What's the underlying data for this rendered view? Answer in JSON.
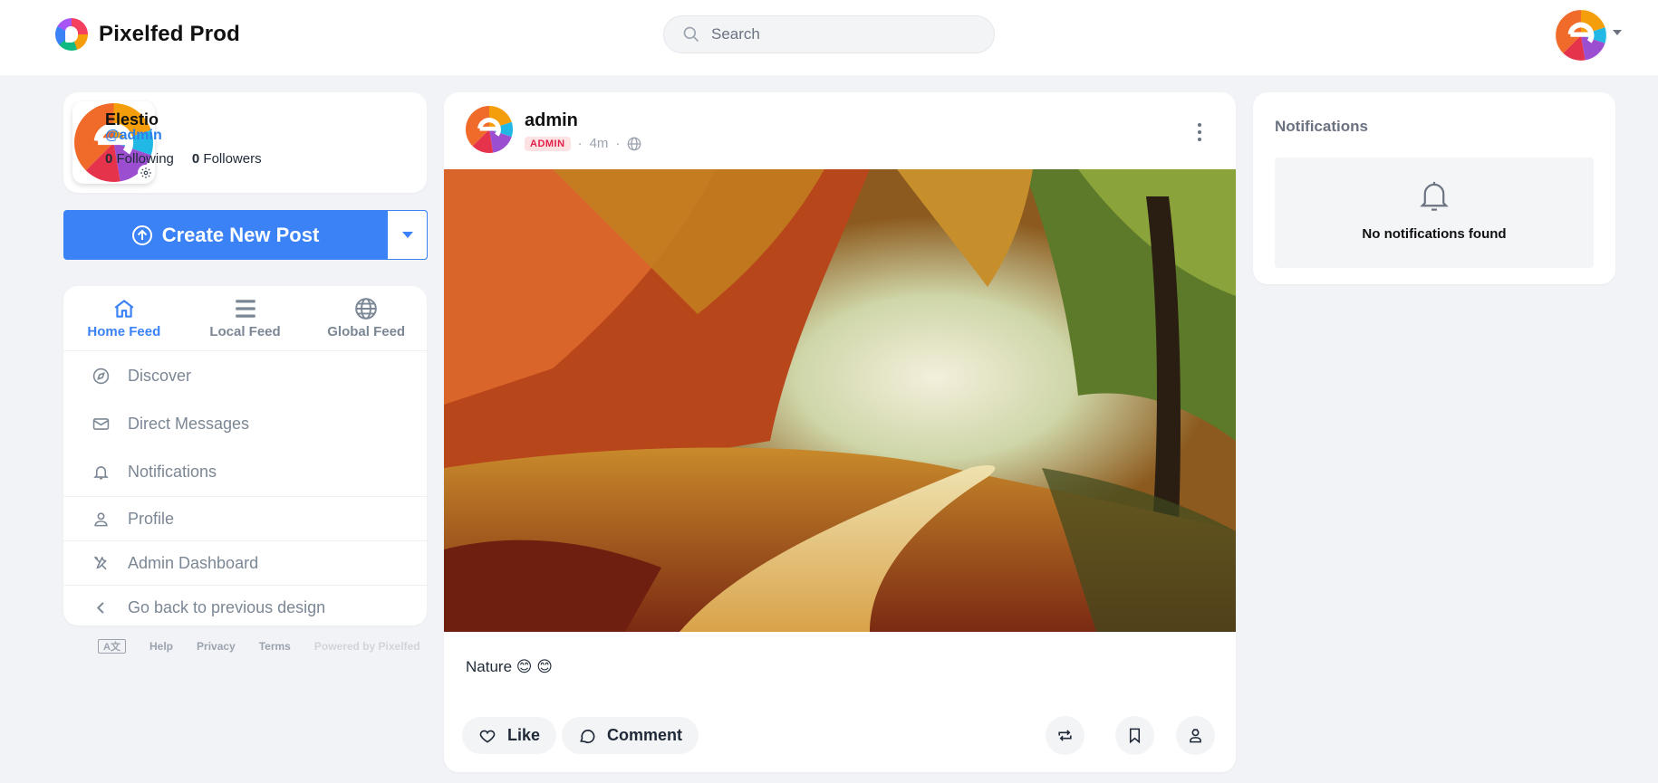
{
  "brand": {
    "name": "Pixelfed Prod"
  },
  "search": {
    "placeholder": "Search"
  },
  "profile": {
    "display_name": "Elestio",
    "handle": "@admin",
    "following_count": "0",
    "following_label": "Following",
    "followers_count": "0",
    "followers_label": "Followers"
  },
  "create_post": {
    "label": "Create New Post"
  },
  "feeds": [
    {
      "label": "Home Feed",
      "icon": "home-icon",
      "active": true
    },
    {
      "label": "Local Feed",
      "icon": "list-icon",
      "active": false
    },
    {
      "label": "Global Feed",
      "icon": "globe-icon",
      "active": false
    }
  ],
  "nav": {
    "items": [
      {
        "label": "Discover",
        "icon": "compass-icon"
      },
      {
        "label": "Direct Messages",
        "icon": "envelope-icon"
      },
      {
        "label": "Notifications",
        "icon": "bell-icon"
      },
      {
        "label": "Profile",
        "icon": "user-icon"
      },
      {
        "label": "Admin Dashboard",
        "icon": "tools-icon"
      },
      {
        "label": "Go back to previous design",
        "icon": "chevron-left-icon"
      }
    ]
  },
  "footer": {
    "lang": "A文",
    "help": "Help",
    "privacy": "Privacy",
    "terms": "Terms",
    "powered": "Powered by Pixelfed"
  },
  "post": {
    "username": "admin",
    "badge": "ADMIN",
    "time": "4m",
    "caption": "Nature 😊 😊",
    "like_label": "Like",
    "comment_label": "Comment"
  },
  "notifications": {
    "title": "Notifications",
    "empty_text": "No notifications found"
  },
  "colors": {
    "accent": "#3b82f6",
    "background": "#f1f3f6",
    "admin_badge": "#e11d48"
  }
}
